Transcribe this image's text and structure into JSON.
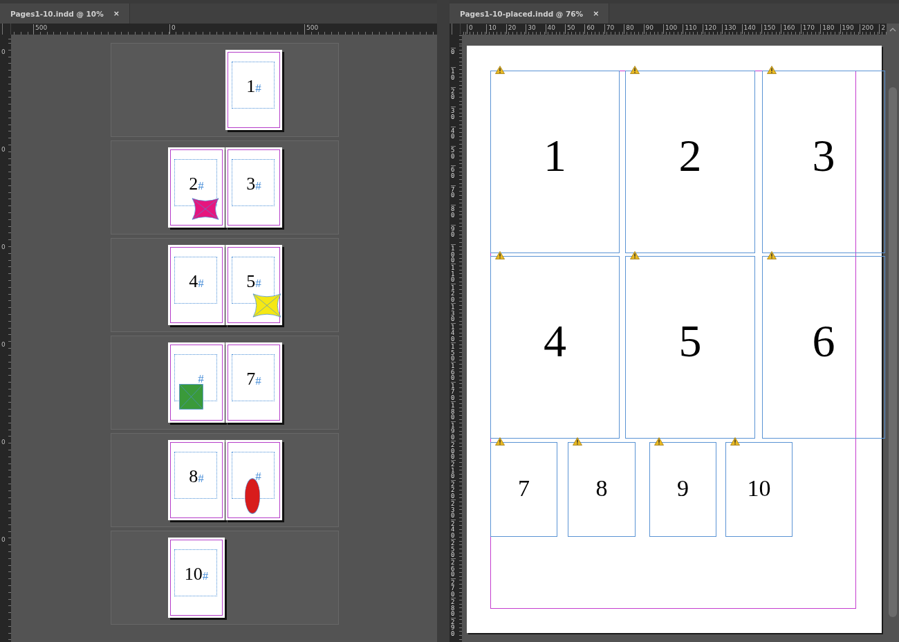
{
  "left_document": {
    "tab": {
      "title": "Pages1-10.indd @ 10%",
      "close": "×",
      "selected": true
    },
    "ruler_labels": [
      "500",
      "0",
      "500"
    ],
    "vertical_ruler_labels": [
      "0",
      "0",
      "0",
      "0",
      "0",
      "0"
    ],
    "spreads": [
      {
        "right_page": {
          "number": "1",
          "marker": "#"
        }
      },
      {
        "left_page": {
          "number": "2",
          "marker": "#",
          "object": {
            "kind": "star",
            "color": "#e6157e"
          }
        },
        "right_page": {
          "number": "3",
          "marker": "#"
        }
      },
      {
        "left_page": {
          "number": "4",
          "marker": "#"
        },
        "right_page": {
          "number": "5",
          "marker": "#",
          "object": {
            "kind": "star",
            "color": "#f5e814"
          }
        }
      },
      {
        "left_page": {
          "marker": "#",
          "object": {
            "kind": "rectangle",
            "color": "#3a9a3a"
          }
        },
        "right_page": {
          "number": "7",
          "marker": "#"
        }
      },
      {
        "left_page": {
          "number": "8",
          "marker": "#"
        },
        "right_page": {
          "marker": "#",
          "object": {
            "kind": "ellipse",
            "color": "#d81c1c"
          }
        }
      },
      {
        "left_page": {
          "number": "10",
          "marker": "#"
        }
      }
    ]
  },
  "right_document": {
    "tab": {
      "title": "Pages1-10-placed.indd @ 76%",
      "close": "×",
      "selected": true
    },
    "ruler_labels": [
      "0",
      "10",
      "20",
      "30",
      "40",
      "50",
      "60",
      "70",
      "80",
      "90",
      "100",
      "110",
      "120",
      "130",
      "140",
      "150",
      "160",
      "170",
      "180",
      "190",
      "200",
      "2"
    ],
    "vertical_ruler_labels": [
      "0",
      "10",
      "20",
      "30",
      "40",
      "50",
      "60",
      "70",
      "80",
      "90",
      "100",
      "110",
      "120",
      "130",
      "140",
      "150",
      "160",
      "170",
      "180",
      "190",
      "200",
      "210",
      "220",
      "230",
      "240",
      "250",
      "260",
      "270",
      "280",
      "290"
    ],
    "frames": [
      {
        "number": "1",
        "warning": true
      },
      {
        "number": "2",
        "warning": true
      },
      {
        "number": "3",
        "warning": true
      },
      {
        "number": "4",
        "warning": true
      },
      {
        "number": "5",
        "warning": true
      },
      {
        "number": "6",
        "warning": true
      },
      {
        "number": "7",
        "warning": true
      },
      {
        "number": "8",
        "warning": true
      },
      {
        "number": "9",
        "warning": true
      },
      {
        "number": "10",
        "warning": true
      }
    ]
  }
}
